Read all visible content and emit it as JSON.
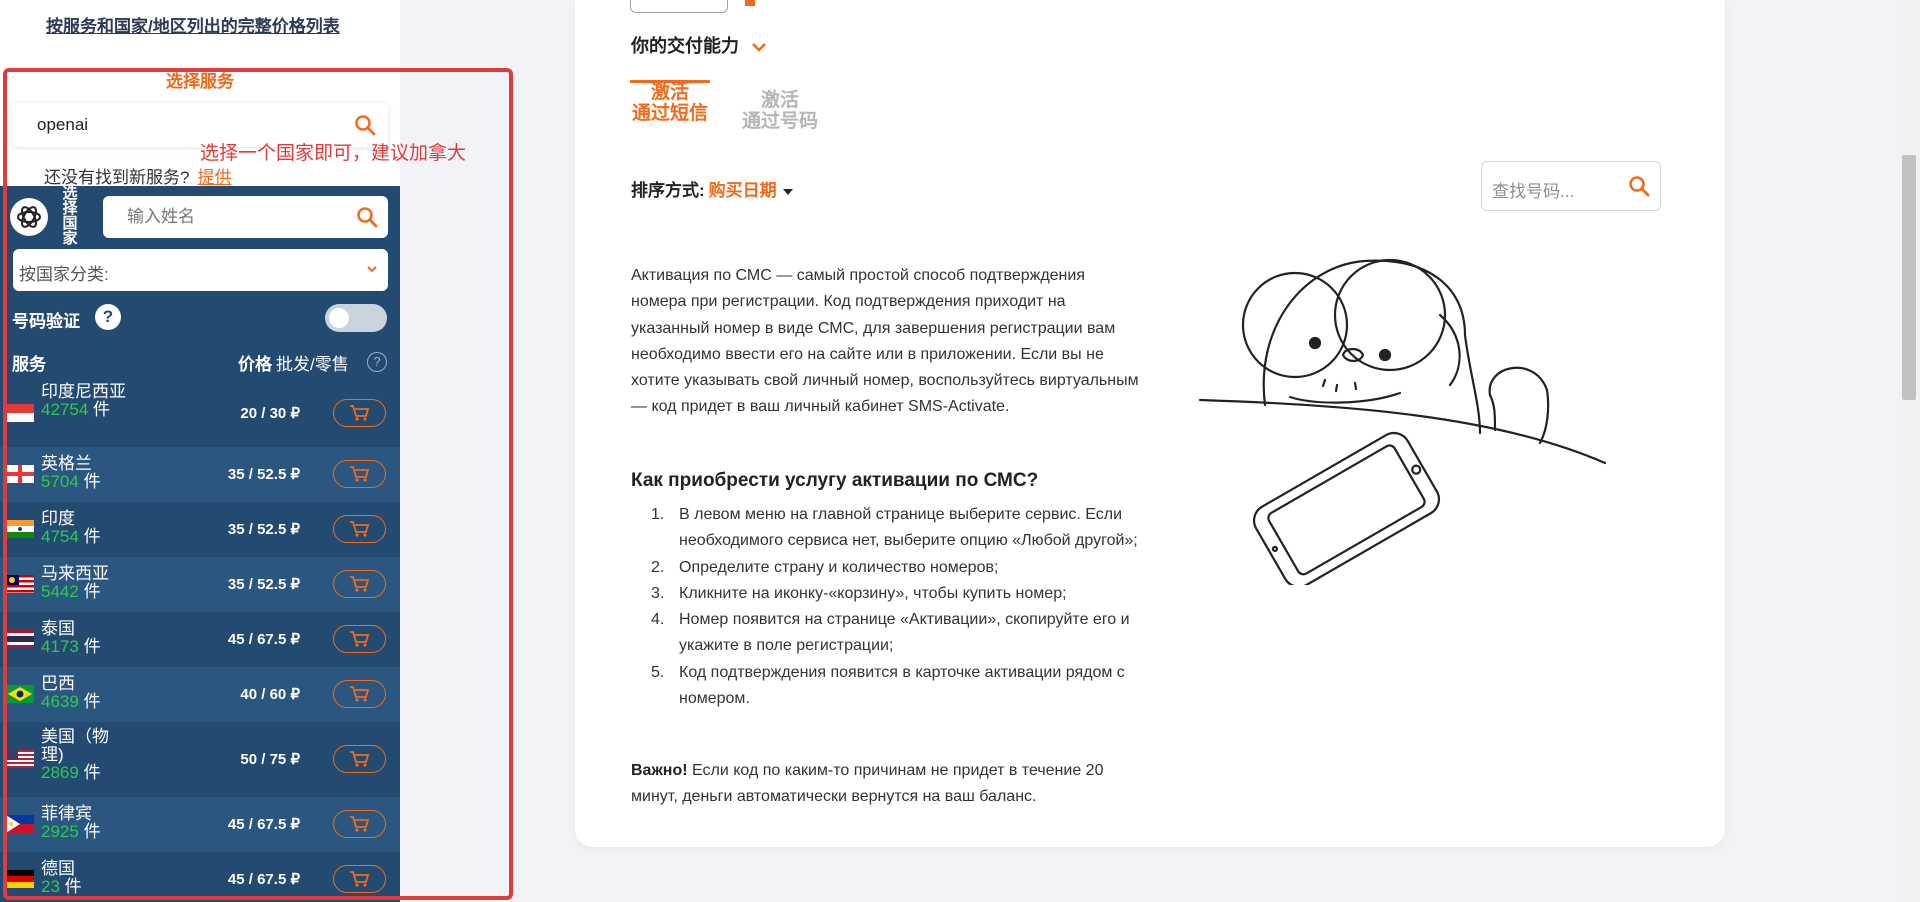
{
  "sidebar": {
    "full_price_link": "按服务和国家/地区列出的完整价格列表",
    "select_service_title": "选择服务",
    "service_search_value": "openai",
    "not_found_text": "还没有找到新服务?",
    "not_found_link": "提供",
    "select_country_vertical": "选择国家",
    "name_search_placeholder": "输入姓名",
    "category_label": "按国家分类:",
    "verify_label": "号码验证",
    "help_badge": "?",
    "col_service": "服务",
    "col_price": "价格",
    "col_price_sub": "批发/零售",
    "countries": [
      {
        "name": "印度尼西亚",
        "count": "42754",
        "unit": "件",
        "price": "20 / 30 ₽",
        "flag": "indonesia-flag"
      },
      {
        "name": "英格兰",
        "count": "5704",
        "unit": "件",
        "price": "35 / 52.5 ₽",
        "flag": "england-flag"
      },
      {
        "name": "印度",
        "count": "4754",
        "unit": "件",
        "price": "35 / 52.5 ₽",
        "flag": "india-flag"
      },
      {
        "name": "马来西亚",
        "count": "5442",
        "unit": "件",
        "price": "35 / 52.5 ₽",
        "flag": "malaysia-flag"
      },
      {
        "name": "泰国",
        "count": "4173",
        "unit": "件",
        "price": "45 / 67.5 ₽",
        "flag": "thailand-flag"
      },
      {
        "name": "巴西",
        "count": "4639",
        "unit": "件",
        "price": "40 / 60 ₽",
        "flag": "brazil-flag"
      },
      {
        "name": "美国（物理)",
        "count": "2869",
        "unit": "件",
        "price": "50 / 75 ₽",
        "flag": "usa-flag"
      },
      {
        "name": "菲律宾",
        "count": "2925",
        "unit": "件",
        "price": "45 / 67.5 ₽",
        "flag": "philippines-flag"
      },
      {
        "name": "德国",
        "count": "23",
        "unit": "件",
        "price": "45 / 67.5 ₽",
        "flag": "germany-flag"
      }
    ]
  },
  "annotation": "选择一个国家即可，建议加拿大",
  "main": {
    "delivery_label": "你的交付能力",
    "tab_sms_line1": "激活",
    "tab_sms_line2": "通过短信",
    "tab_num_line1": "激活",
    "tab_num_line2": "通过号码",
    "sort_label": "排序方式:",
    "sort_value": "购买日期",
    "number_search_placeholder": "查找号码...",
    "description": "Активация по СМС — самый простой способ подтверждения номера при регистрации. Код подтверждения приходит на указанный номер в виде СМС, для завершения регистрации вам необходимо ввести его на сайте или в приложении. Если вы не хотите указывать свой личный номер, воспользуйтесь виртуальным — код придет в ваш личный кабинет SMS-Activate.",
    "howto_title": "Как приобрести услугу активации по СМС?",
    "steps": [
      {
        "n": "1.",
        "text": "В левом меню на главной странице выберите сервис. Если необходимого сервиса нет, выберите опцию «Любой другой»;"
      },
      {
        "n": "2.",
        "text": "Определите страну и количество номеров;"
      },
      {
        "n": "3.",
        "text": "Кликните на иконку-«корзину», чтобы купить номер;"
      },
      {
        "n": "4.",
        "text": "Номер появится на странице «Активации», скопируйте его и укажите в поле регистрации;"
      },
      {
        "n": "5.",
        "text": "Код подтверждения появится в карточке активации рядом с номером."
      }
    ],
    "important_label": "Важно!",
    "important_text": " Если код по каким-то причинам не придет в течение 20 минут, деньги автоматически вернутся на ваш баланс."
  },
  "colors": {
    "accent": "#f26a1b",
    "panel": "#234a70",
    "panel_alt": "#2b5680",
    "count_green": "#2ecb4e",
    "annotation_red": "#e03b3b"
  }
}
